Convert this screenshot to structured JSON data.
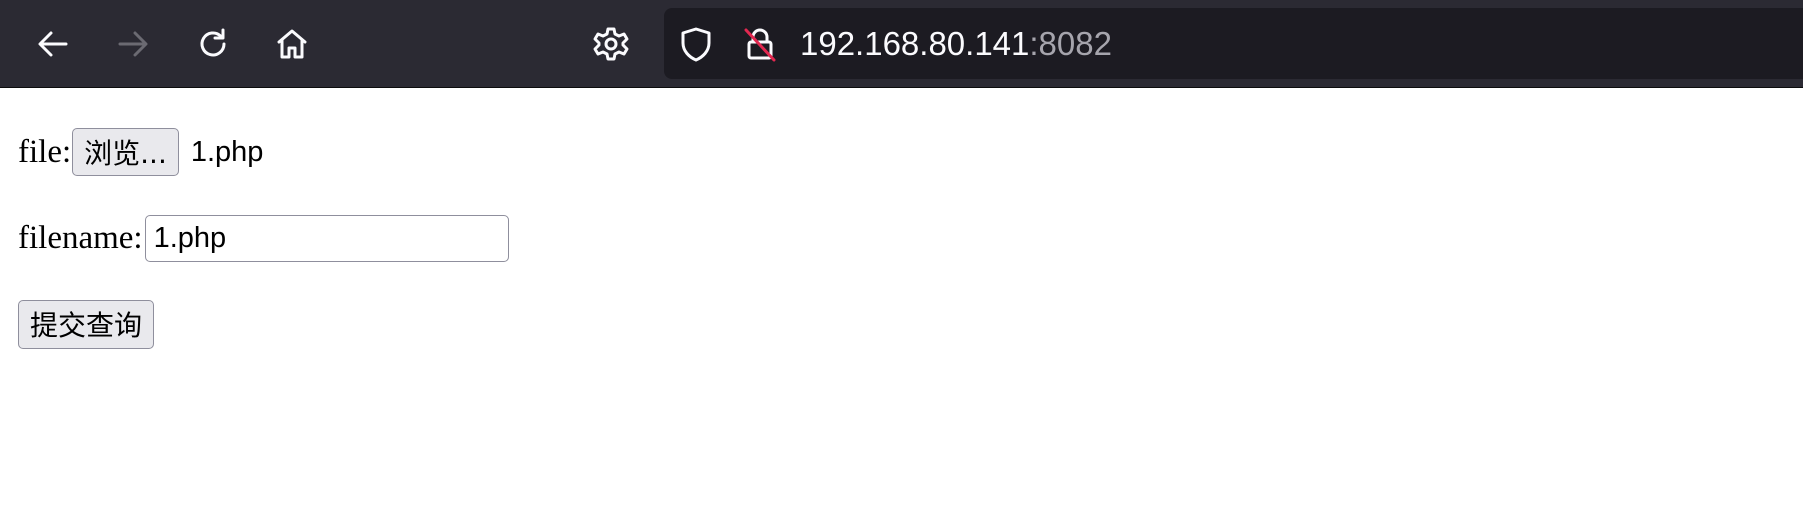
{
  "browser": {
    "url_host": "192.168.80.141",
    "url_port": ":8082",
    "icons": {
      "back": "back-arrow-icon",
      "forward": "forward-arrow-icon",
      "reload": "reload-icon",
      "home": "home-icon",
      "settings": "gear-icon",
      "tracking_protection": "shield-icon",
      "connection": "insecure-lock-icon"
    },
    "forward_enabled": false,
    "colors": {
      "toolbar_bg": "#2b2a33",
      "urlbar_bg": "#1c1b22",
      "icon": "#fbfbfe",
      "icon_disabled": "#6b6a72",
      "insecure_slash": "#e22850"
    }
  },
  "form": {
    "file_label": "file:",
    "browse_button_label": "浏览...",
    "selected_file_name": "1.php",
    "filename_label": "filename:",
    "filename_value": "1.php",
    "submit_button_label": "提交查询"
  }
}
